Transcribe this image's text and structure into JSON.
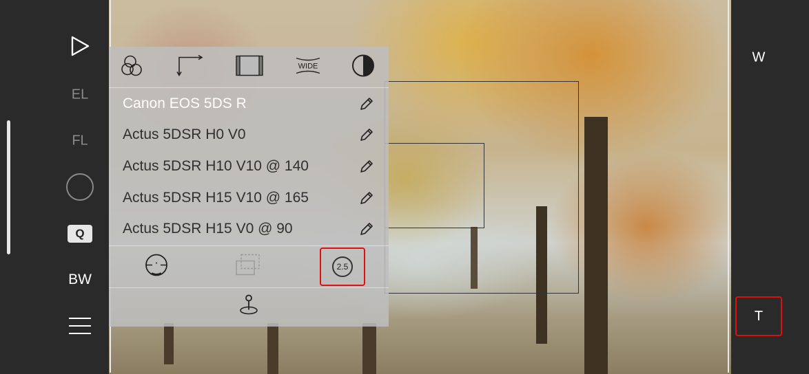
{
  "left_toolbar": {
    "items": [
      {
        "name": "play-icon"
      },
      {
        "label": "EL"
      },
      {
        "label": "FL"
      },
      {
        "name": "circle-icon"
      },
      {
        "label": "Q"
      },
      {
        "label": "BW"
      },
      {
        "name": "menu-icon"
      }
    ]
  },
  "panel": {
    "tools": [
      "overlap-circles-icon",
      "corner-arrow-icon",
      "frame-icon",
      "wide-icon",
      "contrast-icon"
    ],
    "wide_label": "WIDE",
    "lenses": [
      {
        "name": "Canon EOS 5DS R"
      },
      {
        "name": "Actus 5DSR H0 V0"
      },
      {
        "name": "Actus 5DSR H10 V10 @ 140"
      },
      {
        "name": "Actus 5DSR H15 V10 @ 165"
      },
      {
        "name": "Actus 5DSR H15 V0 @ 90"
      }
    ],
    "zoom_factor": "2.5"
  },
  "right_toolbar": {
    "wide_label": "W",
    "tele_label": "T"
  },
  "colors": {
    "highlight": "#e01010",
    "toolbar_bg": "#2a2a2a"
  }
}
